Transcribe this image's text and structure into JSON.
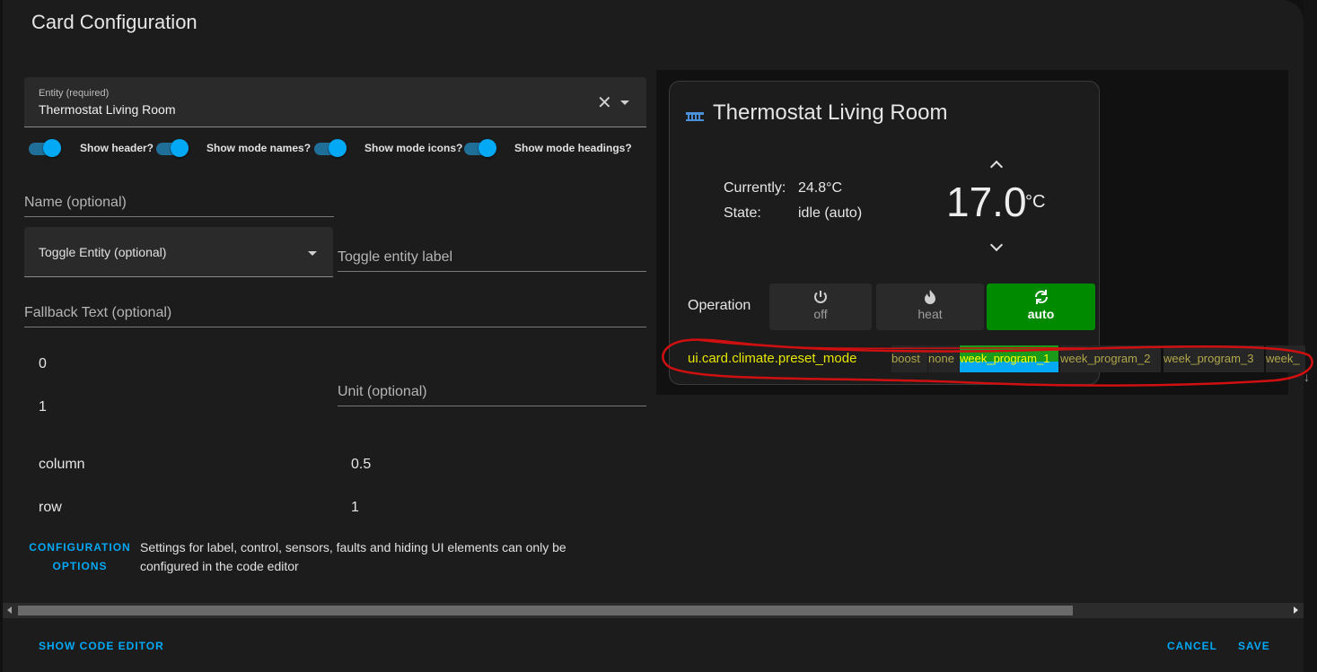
{
  "dialog": {
    "title": "Card Configuration"
  },
  "editor": {
    "entity": {
      "label": "Entity (required)",
      "value": "Thermostat Living Room"
    },
    "toggles": [
      {
        "label": "Show header?",
        "on": true
      },
      {
        "label": "Show mode names?",
        "on": true
      },
      {
        "label": "Show mode icons?",
        "on": true
      },
      {
        "label": "Show mode headings?",
        "on": true
      }
    ],
    "name_placeholder": "Name (optional)",
    "toggle_entity_placeholder": "Toggle Entity (optional)",
    "toggle_entity_label_placeholder": "Toggle entity label",
    "fallback_placeholder": "Fallback Text (optional)",
    "value_0": "0",
    "value_1": "1",
    "unit_placeholder": "Unit (optional)",
    "column_label": "column",
    "column_value": "0.5",
    "row_label": "row",
    "row_value": "1",
    "config_options_line1": "CONFIGURATION",
    "config_options_line2": "OPTIONS",
    "config_text": "Settings for label, control, sensors, faults and hiding UI elements can only be configured in the code editor"
  },
  "footer": {
    "show_code_editor": "SHOW CODE EDITOR",
    "cancel": "CANCEL",
    "save": "SAVE"
  },
  "preview": {
    "title": "Thermostat Living Room",
    "currently_label": "Currently:",
    "currently_value": "24.8°C",
    "state_label": "State:",
    "state_value": "idle (auto)",
    "target_temp": "17.0",
    "target_unit": "°C",
    "operation_label": "Operation",
    "modes": [
      {
        "name": "off",
        "icon": "power-icon",
        "active": false
      },
      {
        "name": "heat",
        "icon": "fire-icon",
        "active": false
      },
      {
        "name": "auto",
        "icon": "sync-icon",
        "active": true
      }
    ],
    "preset_label": "ui.card.climate.preset_mode",
    "presets": [
      {
        "name": "boost",
        "active": false
      },
      {
        "name": "none",
        "active": false
      },
      {
        "name": "week_program_1",
        "active": true
      },
      {
        "name": "week_program_2",
        "active": false
      },
      {
        "name": "week_program_3",
        "active": false
      },
      {
        "name": "week_",
        "active": false
      }
    ]
  },
  "colors": {
    "accent": "#03a9f4",
    "active_mode": "#008a00",
    "annotation": "#e00000"
  }
}
